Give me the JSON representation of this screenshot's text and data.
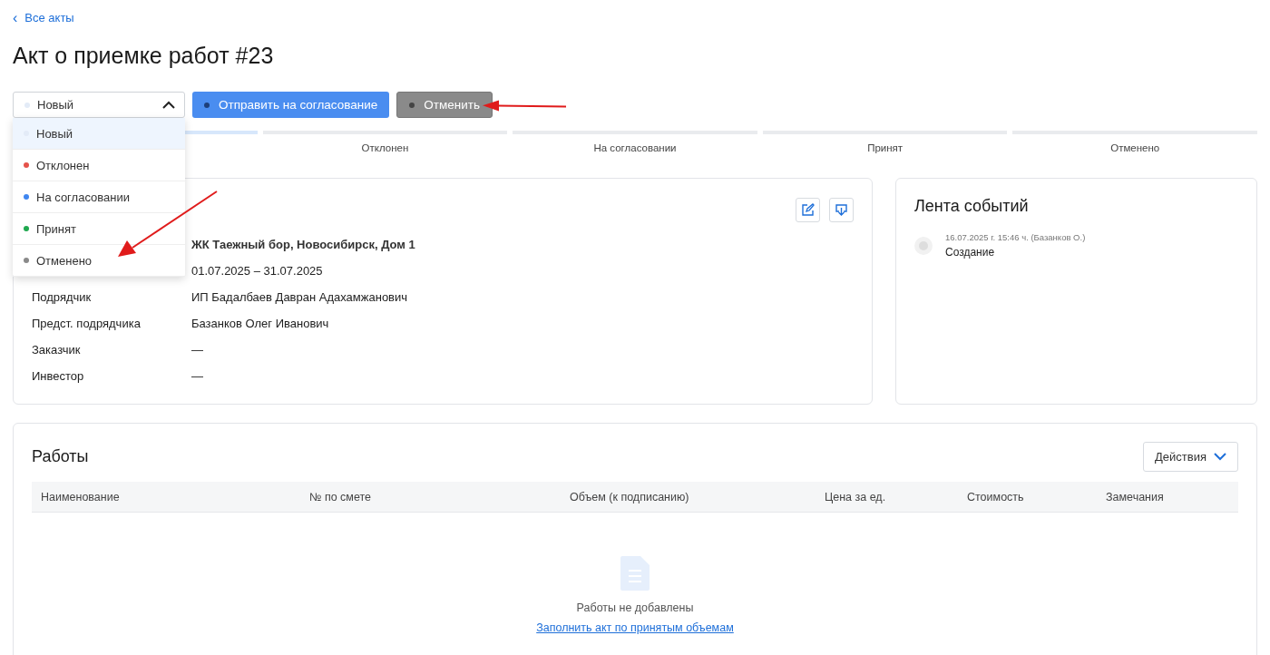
{
  "back_link": {
    "icon": "‹",
    "label": "Все акты"
  },
  "title": "Акт о приемке работ #23",
  "status_dropdown": {
    "value": "Новый",
    "color": "#e3ebf7",
    "expanded": true,
    "options": [
      {
        "label": "Новый",
        "color": "#e3ebf7",
        "selected": true
      },
      {
        "label": "Отклонен",
        "color": "#e5534b",
        "selected": false
      },
      {
        "label": "На согласовании",
        "color": "#3f86f0",
        "selected": false
      },
      {
        "label": "Принят",
        "color": "#1fa84f",
        "selected": false
      },
      {
        "label": "Отменено",
        "color": "#8a8a8a",
        "selected": false
      }
    ]
  },
  "buttons": [
    {
      "label": "Отправить на согласование",
      "kind": "primary"
    },
    {
      "label": "Отменить",
      "kind": "secondary"
    }
  ],
  "stepper": [
    {
      "active": true
    },
    {
      "label": "Отклонен",
      "active": false
    },
    {
      "label": "На согласовании",
      "active": false
    },
    {
      "label": "Принят",
      "active": false
    },
    {
      "label": "Отменено",
      "active": false
    }
  ],
  "details": {
    "rows": [
      {
        "value": "ЖК Таежный бор, Новосибирск, Дом 1",
        "bold": true
      },
      {
        "value": "01.07.2025 – 31.07.2025",
        "bold": false
      },
      {
        "label": "Подрядчик",
        "value": "ИП Бадалбаев Давран Адахамжанович",
        "bold": false
      },
      {
        "label": "Предст. подрядчика",
        "value": "Базанков Олег Иванович",
        "bold": false
      },
      {
        "label": "Заказчик",
        "value": "—",
        "bold": false
      },
      {
        "label": "Инвестор",
        "value": "—",
        "bold": false
      }
    ]
  },
  "events": {
    "title": "Лента событий",
    "items": [
      {
        "meta": "16.07.2025 г. 15:46 ч. (Базанков О.)",
        "text": "Создание"
      }
    ]
  },
  "works": {
    "title": "Работы",
    "actions_button": "Действия",
    "columns": [
      "Наименование",
      "№ по смете",
      "Объем (к подписанию)",
      "Цена за ед.",
      "Стоимость",
      "Замечания"
    ],
    "empty": {
      "text": "Работы не добавлены",
      "link": "Заполнить акт по принятым объемам"
    }
  }
}
